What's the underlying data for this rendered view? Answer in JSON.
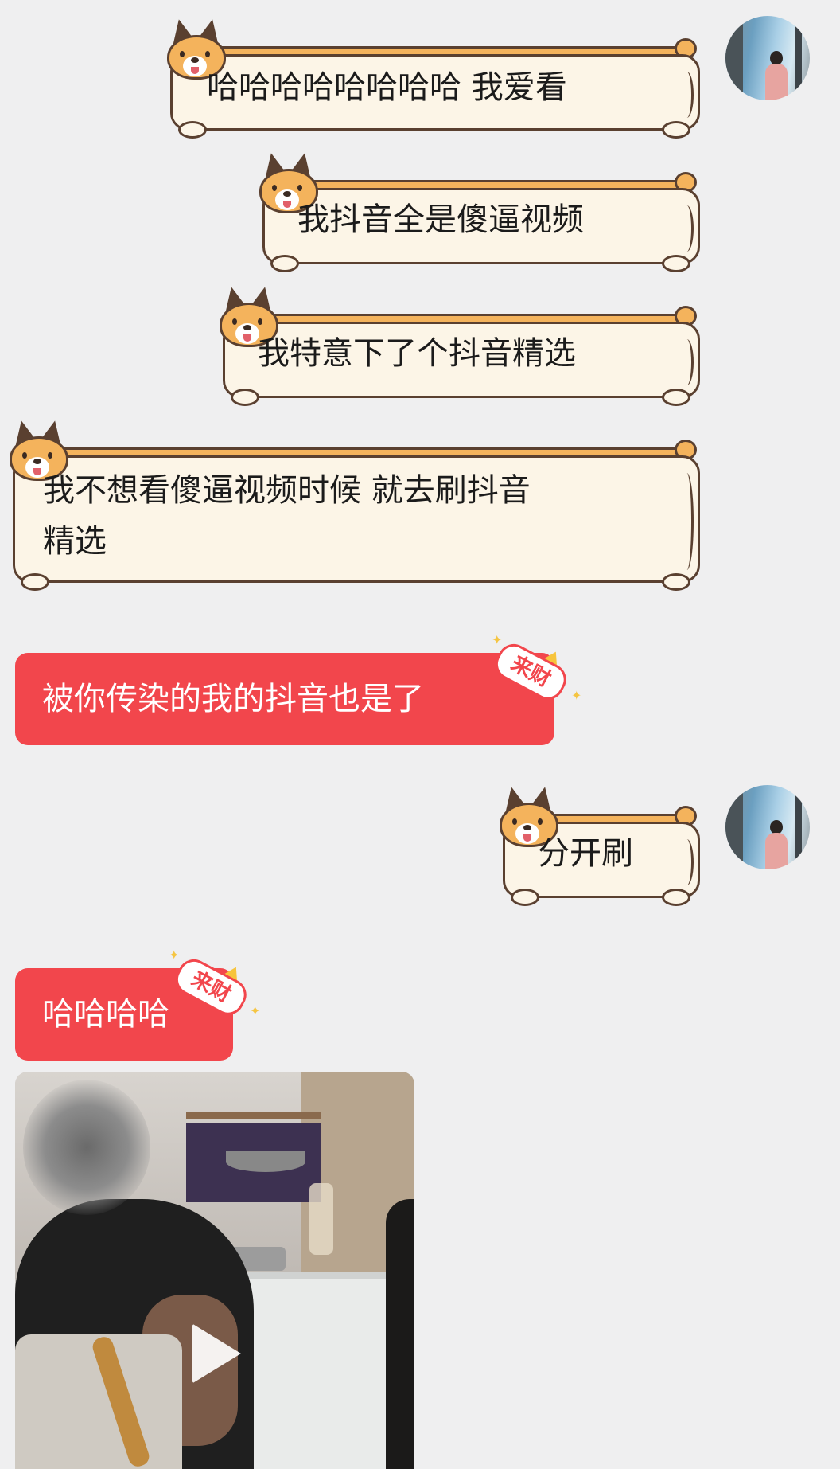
{
  "messages": {
    "m1": "哈哈哈哈哈哈哈哈 我爱看",
    "m2": "我抖音全是傻逼视频",
    "m3": "我特意下了个抖音精选",
    "m4": "我不想看傻逼视频时候 就去刷抖音\n精选",
    "m5": "被你传染的我的抖音也是了",
    "m6": "分开刷",
    "m7": "哈哈哈哈"
  },
  "sticker_label": "来财",
  "colors": {
    "background": "#efeff0",
    "incoming_bubble": "#f2464c",
    "corgi_bubble": "#fcf5e7",
    "corgi_fur": "#f4b35c"
  },
  "icons": {
    "avatar": "avatar-photo",
    "corgi": "corgi-bubble-frame",
    "play": "play-icon"
  }
}
